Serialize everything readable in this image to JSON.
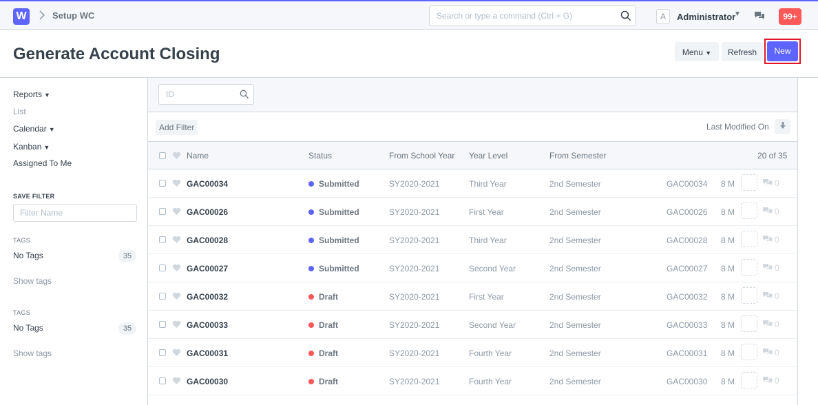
{
  "navbar": {
    "logo_letter": "W",
    "breadcrumb": "Setup WC",
    "search_placeholder": "Search or type a command (Ctrl + G)",
    "avatar_letter": "A",
    "user_name": "Administrator",
    "notifications": "99+"
  },
  "page": {
    "title": "Generate Account Closing",
    "menu_label": "Menu",
    "refresh_label": "Refresh",
    "new_label": "New"
  },
  "sidebar": {
    "views": [
      "Reports",
      "List",
      "Calendar",
      "Kanban",
      "Assigned To Me"
    ],
    "save_filter_label": "SAVE FILTER",
    "filter_name_placeholder": "Filter Name",
    "tag_groups": [
      {
        "label": "TAGS",
        "item": "No Tags",
        "count": "35",
        "show": "Show tags"
      },
      {
        "label": "TAGS",
        "item": "No Tags",
        "count": "35",
        "show": "Show tags"
      }
    ]
  },
  "list": {
    "id_placeholder": "ID",
    "add_filter": "Add Filter",
    "sort_label": "Last Modified On",
    "columns": {
      "name": "Name",
      "status": "Status",
      "from_school_year": "From School Year",
      "year_level": "Year Level",
      "from_semester": "From Semester"
    },
    "count": "20 of 35",
    "rows": [
      {
        "name": "GAC00034",
        "status": "Submitted",
        "school_year": "SY2020-2021",
        "year_level": "Third Year",
        "semester": "2nd Semester",
        "id": "GAC00034",
        "modified": "8 M",
        "comments": "0"
      },
      {
        "name": "GAC00026",
        "status": "Submitted",
        "school_year": "SY2020-2021",
        "year_level": "First Year",
        "semester": "2nd Semester",
        "id": "GAC00026",
        "modified": "8 M",
        "comments": "0"
      },
      {
        "name": "GAC00028",
        "status": "Submitted",
        "school_year": "SY2020-2021",
        "year_level": "Third Year",
        "semester": "2nd Semester",
        "id": "GAC00028",
        "modified": "8 M",
        "comments": "0"
      },
      {
        "name": "GAC00027",
        "status": "Submitted",
        "school_year": "SY2020-2021",
        "year_level": "Second Year",
        "semester": "2nd Semester",
        "id": "GAC00027",
        "modified": "8 M",
        "comments": "0"
      },
      {
        "name": "GAC00032",
        "status": "Draft",
        "school_year": "SY2020-2021",
        "year_level": "First Year",
        "semester": "2nd Semester",
        "id": "GAC00032",
        "modified": "8 M",
        "comments": "0"
      },
      {
        "name": "GAC00033",
        "status": "Draft",
        "school_year": "SY2020-2021",
        "year_level": "Second Year",
        "semester": "2nd Semester",
        "id": "GAC00033",
        "modified": "8 M",
        "comments": "0"
      },
      {
        "name": "GAC00031",
        "status": "Draft",
        "school_year": "SY2020-2021",
        "year_level": "Fourth Year",
        "semester": "2nd Semester",
        "id": "GAC00031",
        "modified": "8 M",
        "comments": "0"
      },
      {
        "name": "GAC00030",
        "status": "Draft",
        "school_year": "SY2020-2021",
        "year_level": "Fourth Year",
        "semester": "2nd Semester",
        "id": "GAC00030",
        "modified": "8 M",
        "comments": "0"
      }
    ]
  },
  "colors": {
    "accent": "#5e64ff",
    "submitted": "#5e64ff",
    "draft": "#ff5858",
    "highlight": "#e1152a"
  }
}
